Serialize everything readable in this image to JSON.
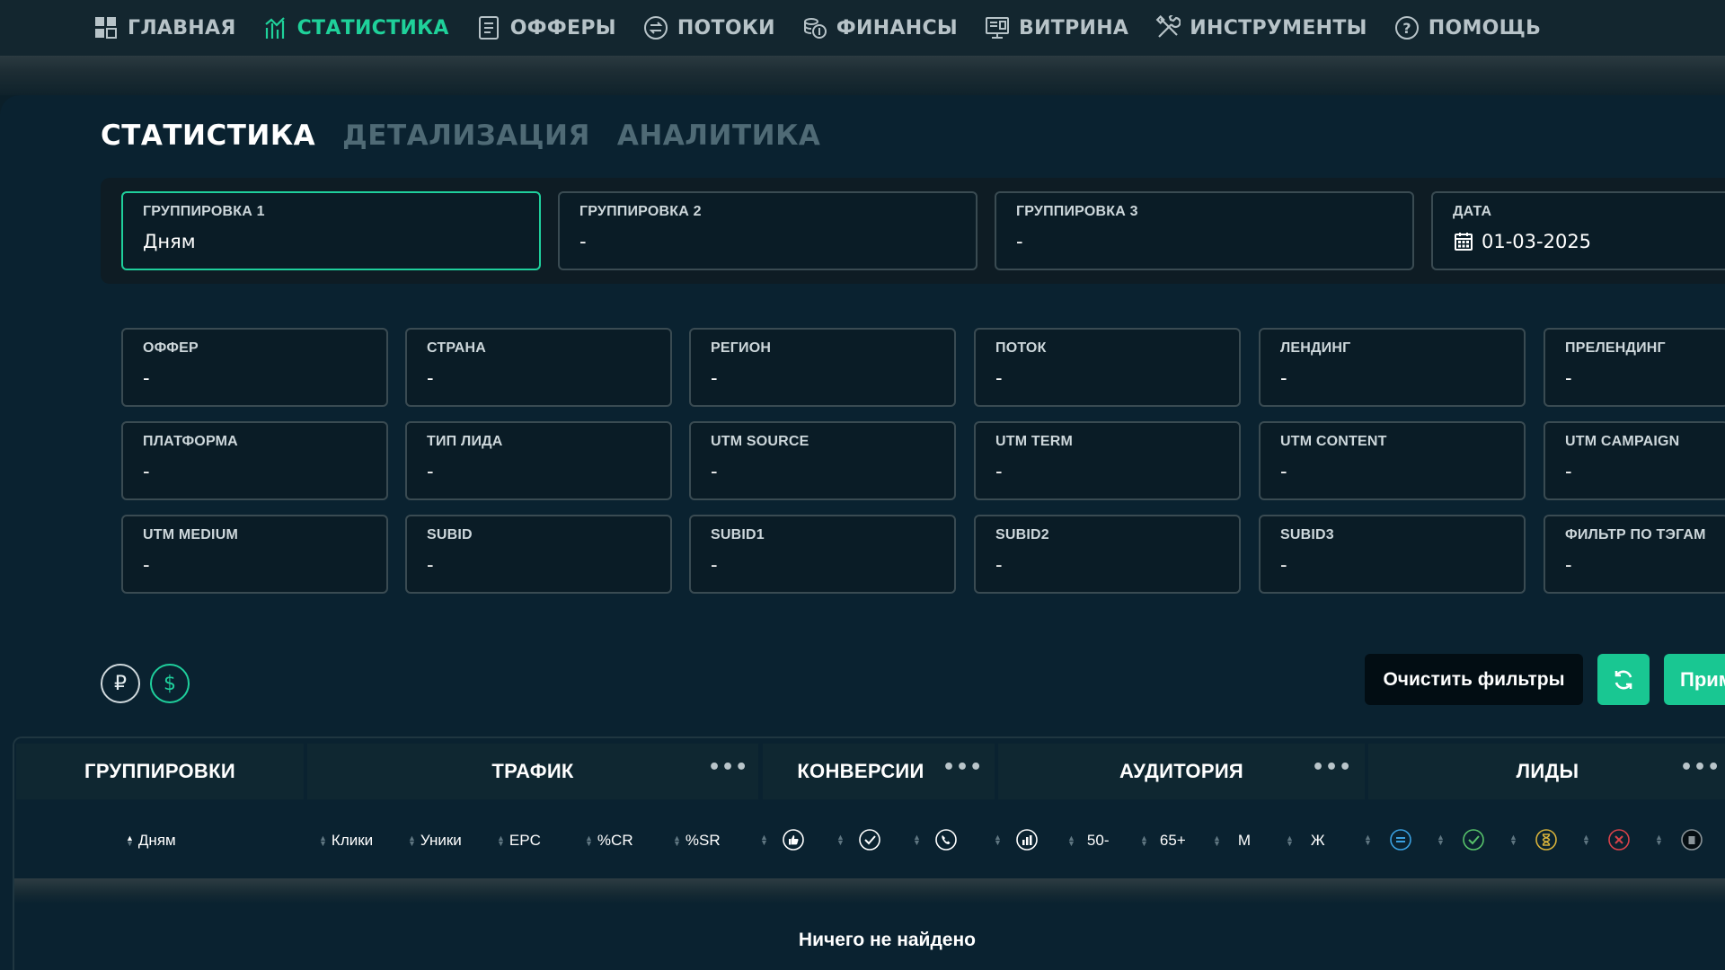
{
  "nav": {
    "items": [
      {
        "label": "ГЛАВНАЯ",
        "icon": "dashboard-icon",
        "active": false
      },
      {
        "label": "СТАТИСТИКА",
        "icon": "statistics-icon",
        "active": true
      },
      {
        "label": "ОФФЕРЫ",
        "icon": "offers-icon",
        "active": false
      },
      {
        "label": "ПОТОКИ",
        "icon": "streams-icon",
        "active": false
      },
      {
        "label": "ФИНАНСЫ",
        "icon": "finance-icon",
        "active": false
      },
      {
        "label": "ВИТРИНА",
        "icon": "showcase-icon",
        "active": false
      },
      {
        "label": "ИНСТРУМЕНТЫ",
        "icon": "tools-icon",
        "active": false
      },
      {
        "label": "ПОМОЩЬ",
        "icon": "help-icon",
        "active": false
      }
    ]
  },
  "subtabs": [
    {
      "label": "СТАТИСТИКА",
      "active": true
    },
    {
      "label": "ДЕТАЛИЗАЦИЯ",
      "active": false
    },
    {
      "label": "АНАЛИТИКА",
      "active": false
    }
  ],
  "groupings": [
    {
      "label": "ГРУППИРОВКА 1",
      "value": "Дням"
    },
    {
      "label": "ГРУППИРОВКА 2",
      "value": "-"
    },
    {
      "label": "ГРУППИРОВКА 3",
      "value": "-"
    }
  ],
  "date": {
    "label": "ДАТА",
    "value": "01-03-2025"
  },
  "filters": [
    {
      "label": "ОФФЕР",
      "value": "-"
    },
    {
      "label": "СТРАНА",
      "value": "-"
    },
    {
      "label": "РЕГИОН",
      "value": "-"
    },
    {
      "label": "ПОТОК",
      "value": "-"
    },
    {
      "label": "ЛЕНДИНГ",
      "value": "-"
    },
    {
      "label": "ПРЕЛЕНДИНГ",
      "value": "-"
    },
    {
      "label": "ПЛАТФОРМА",
      "value": "-"
    },
    {
      "label": "ТИП ЛИДА",
      "value": "-"
    },
    {
      "label": "UTM SOURCE",
      "value": "-"
    },
    {
      "label": "UTM TERM",
      "value": "-"
    },
    {
      "label": "UTM CONTENT",
      "value": "-"
    },
    {
      "label": "UTM CAMPAIGN",
      "value": "-"
    },
    {
      "label": "UTM MEDIUM",
      "value": "-"
    },
    {
      "label": "SUBID",
      "value": "-"
    },
    {
      "label": "SUBID1",
      "value": "-"
    },
    {
      "label": "SUBID2",
      "value": "-"
    },
    {
      "label": "SUBID3",
      "value": "-"
    },
    {
      "label": "ФИЛЬТР ПО ТЭГАМ",
      "value": "-"
    }
  ],
  "currency": {
    "rub": "₽",
    "usd": "$",
    "selected": "usd"
  },
  "actions": {
    "clear_label": "Очистить фильтры",
    "apply_label": "Применить"
  },
  "table": {
    "groups": [
      {
        "label": "ГРУППИРОВКИ"
      },
      {
        "label": "ТРАФИК"
      },
      {
        "label": "КОНВЕРСИИ"
      },
      {
        "label": "АУДИТОРИЯ"
      },
      {
        "label": "ЛИДЫ"
      }
    ],
    "columns": {
      "days": "Дням",
      "clicks": "Клики",
      "uniques": "Уники",
      "epc": "EPC",
      "cr": "%CR",
      "sr": "%SR",
      "age_under": "50-",
      "age_over": "65+",
      "male": "М",
      "female": "Ж"
    },
    "empty_text": "Ничего не найдено"
  },
  "colors": {
    "accent": "#1fd19a",
    "background": "#0a2230",
    "lead_total": "#3aa0e0",
    "lead_approved": "#57c26a",
    "lead_hold": "#d6b13a",
    "lead_rejected": "#d8424a",
    "lead_trash": "#8a9499"
  }
}
